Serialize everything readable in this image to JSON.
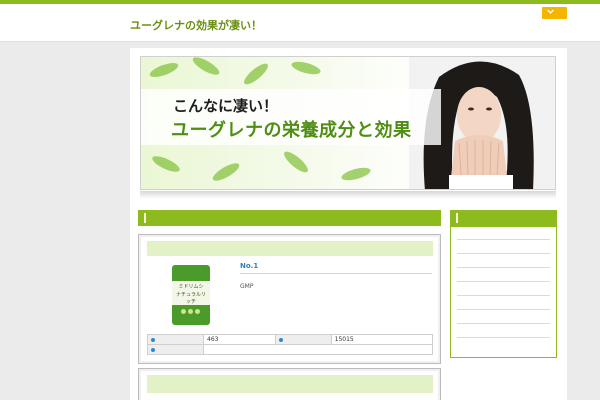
{
  "header": {
    "site_title": "ユーグレナの効果が凄い！",
    "menu_icon": "chevron-down-icon"
  },
  "banner": {
    "line1": "こんなに凄い！",
    "line2": "ユーグレナの栄養成分と効果"
  },
  "product": {
    "rank": "No.1",
    "description": "GMP",
    "image_text_line1": "ミドリムシ",
    "image_text_line2": "ナチュラルリッチ",
    "specs": [
      {
        "label": "",
        "value": "463"
      },
      {
        "label": "",
        "value": "15015"
      }
    ]
  },
  "colors": {
    "accent": "#8dbb1e",
    "menu_button": "#f5b400",
    "rank_text": "#2d7fc0",
    "card_header": "#e3f2c6"
  }
}
